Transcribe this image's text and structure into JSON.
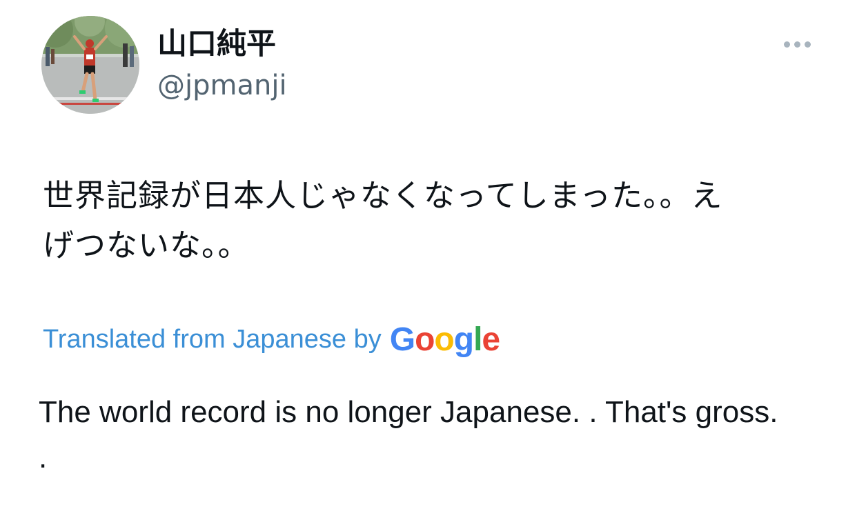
{
  "author": {
    "display_name": "山口純平",
    "handle": "@jpmanji",
    "avatar_icon": "runner-photo-avatar"
  },
  "menu": {
    "more_icon": "ellipsis-icon"
  },
  "tweet": {
    "text": "世界記録が日本人じゃなくなってしまった。。えげつないな。。"
  },
  "translation": {
    "label": "Translated from Japanese by",
    "provider": "Google",
    "provider_letters": [
      "G",
      "o",
      "o",
      "g",
      "l",
      "e"
    ],
    "provider_colors": [
      "#4285F4",
      "#EA4335",
      "#FBBC05",
      "#4285F4",
      "#34A853",
      "#EA4335"
    ],
    "text": "The world record is no longer Japanese. . That's gross. ."
  },
  "colors": {
    "link": "#3b8fd6",
    "secondary_text": "#536471",
    "primary_text": "#0f1419"
  }
}
